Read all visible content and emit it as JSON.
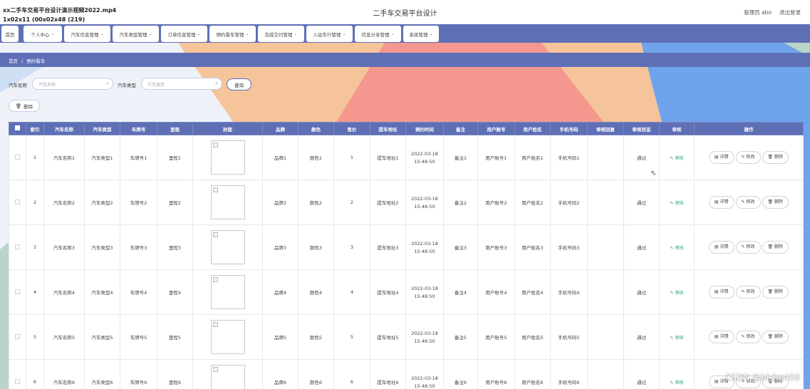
{
  "overlay": {
    "line1": "xx二手车交易平台设计演示视频2022.mp4",
    "line2": "1x02x11 (00x02x48 (219)"
  },
  "header": {
    "title": "二手车交易平台设计",
    "admin": "管理员 abo",
    "logout": "退出登录"
  },
  "nav": [
    {
      "label": "首页",
      "dropdown": false
    },
    {
      "label": "个人中心",
      "dropdown": true
    },
    {
      "label": "汽车信息管理",
      "dropdown": true
    },
    {
      "label": "汽车类型管理",
      "dropdown": true
    },
    {
      "label": "订单信息管理",
      "dropdown": true
    },
    {
      "label": "预约看车管理",
      "dropdown": true
    },
    {
      "label": "完成交付管理",
      "dropdown": true
    },
    {
      "label": "入驻车行管理",
      "dropdown": true
    },
    {
      "label": "信息分享管理",
      "dropdown": true
    },
    {
      "label": "系统管理",
      "dropdown": true
    }
  ],
  "breadcrumb": {
    "home": "首页",
    "sep": "/",
    "current": "预约看车"
  },
  "search": {
    "name_label": "汽车名称",
    "name_placeholder": "汽车名称",
    "type_label": "汽车类型",
    "type_placeholder": "汽车类型",
    "query_button": "查询"
  },
  "toolbar": {
    "delete_button": "删除"
  },
  "table": {
    "columns": [
      "索引",
      "汽车名称",
      "汽车类型",
      "车牌号",
      "里程",
      "封面",
      "品牌",
      "颜色",
      "售价",
      "提车地址",
      "预约时间",
      "备注",
      "用户账号",
      "用户姓名",
      "手机号码",
      "审核回复",
      "审核状态",
      "审核",
      "操作"
    ],
    "audit_label": "审核",
    "actions": {
      "detail": "详情",
      "edit": "修改",
      "delete": "删除"
    },
    "rows": [
      {
        "index": "1",
        "name": "汽车名称1",
        "type": "汽车类型1",
        "plate": "车牌号1",
        "mileage": "里程1",
        "brand": "品牌1",
        "color": "颜色1",
        "price": "1",
        "address": "提车地址1",
        "date": "2022-03-18",
        "time": "15:48:50",
        "note": "备注1",
        "account": "用户账号1",
        "username": "用户姓名1",
        "phone": "手机号码1",
        "reply": "",
        "status": "通过"
      },
      {
        "index": "2",
        "name": "汽车名称2",
        "type": "汽车类型2",
        "plate": "车牌号2",
        "mileage": "里程2",
        "brand": "品牌2",
        "color": "颜色2",
        "price": "2",
        "address": "提车地址2",
        "date": "2022-03-18",
        "time": "15:48:50",
        "note": "备注2",
        "account": "用户账号2",
        "username": "用户姓名2",
        "phone": "手机号码2",
        "reply": "",
        "status": "通过"
      },
      {
        "index": "3",
        "name": "汽车名称3",
        "type": "汽车类型3",
        "plate": "车牌号3",
        "mileage": "里程3",
        "brand": "品牌3",
        "color": "颜色3",
        "price": "3",
        "address": "提车地址3",
        "date": "2022-03-18",
        "time": "15:48:50",
        "note": "备注3",
        "account": "用户账号3",
        "username": "用户姓名3",
        "phone": "手机号码3",
        "reply": "",
        "status": "通过"
      },
      {
        "index": "4",
        "name": "汽车名称4",
        "type": "汽车类型4",
        "plate": "车牌号4",
        "mileage": "里程4",
        "brand": "品牌4",
        "color": "颜色4",
        "price": "4",
        "address": "提车地址4",
        "date": "2022-03-18",
        "time": "15:48:50",
        "note": "备注4",
        "account": "用户账号4",
        "username": "用户姓名4",
        "phone": "手机号码4",
        "reply": "",
        "status": "通过"
      },
      {
        "index": "5",
        "name": "汽车名称5",
        "type": "汽车类型5",
        "plate": "车牌号5",
        "mileage": "里程5",
        "brand": "品牌5",
        "color": "颜色5",
        "price": "5",
        "address": "提车地址5",
        "date": "2022-03-18",
        "time": "15:48:50",
        "note": "备注5",
        "account": "用户账号5",
        "username": "用户姓名5",
        "phone": "手机号码5",
        "reply": "",
        "status": "通过"
      },
      {
        "index": "6",
        "name": "汽车名称6",
        "type": "汽车类型6",
        "plate": "车牌号6",
        "mileage": "里程6",
        "brand": "品牌6",
        "color": "颜色6",
        "price": "6",
        "address": "提车地址6",
        "date": "2022-03-18",
        "time": "15:48:50",
        "note": "备注6",
        "account": "用户账号6",
        "username": "用户姓名6",
        "phone": "手机号码6",
        "reply": "",
        "status": "通过"
      }
    ]
  },
  "watermark": "CSDN @bishe409",
  "colors": {
    "primary": "#5f6fb6",
    "peach": "#f6c49a",
    "salmon": "#f4978e",
    "sky": "#6fa3ec",
    "audit": "#2aa56b"
  }
}
